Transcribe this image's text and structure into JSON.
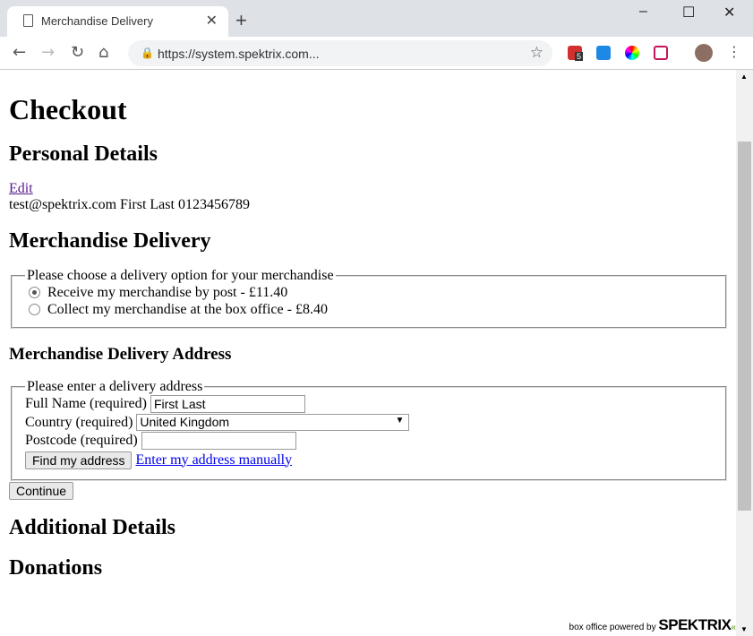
{
  "browser": {
    "tab_title": "Merchandise Delivery",
    "url": "https://system.spektrix.com...",
    "extension_badge": "5"
  },
  "page": {
    "title": "Checkout",
    "personal": {
      "heading": "Personal Details",
      "edit": "Edit",
      "summary": "test@spektrix.com First Last 0123456789"
    },
    "delivery": {
      "heading": "Merchandise Delivery",
      "legend": "Please choose a delivery option for your merchandise",
      "options": [
        {
          "label": "Receive my merchandise by post - £11.40",
          "selected": true
        },
        {
          "label": "Collect my merchandise at the box office - £8.40",
          "selected": false
        }
      ]
    },
    "address": {
      "heading": "Merchandise Delivery Address",
      "legend": "Please enter a delivery address",
      "full_name_label": "Full Name (required)",
      "full_name_value": "First Last",
      "country_label": "Country (required)",
      "country_value": "United Kingdom",
      "postcode_label": "Postcode (required)",
      "postcode_value": "",
      "find_button": "Find my address",
      "manual_link": "Enter my address manually"
    },
    "continue": "Continue",
    "additional_heading": "Additional Details",
    "donations_heading": "Donations"
  },
  "footer": {
    "text": "box office powered by",
    "brand": "SPEKTRIX"
  }
}
